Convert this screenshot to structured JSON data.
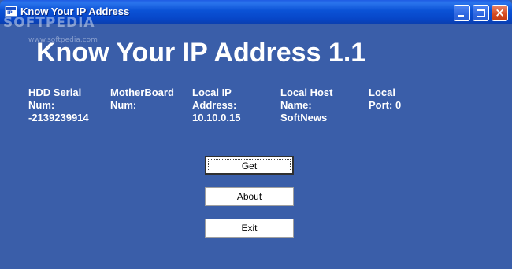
{
  "window": {
    "title": "Know Your IP Address",
    "watermark": "SOFTPEDIA",
    "watermark_url": "www.softpedia.com",
    "controls": {
      "minimize": "minimize",
      "maximize": "maximize",
      "close": "×"
    }
  },
  "main": {
    "headline": "Know Your IP Address 1.1",
    "info": [
      {
        "lines": [
          "HDD Serial",
          "Num:",
          "-2139239914"
        ]
      },
      {
        "lines": [
          "MotherBoard",
          "Num:"
        ]
      },
      {
        "lines": [
          "Local IP",
          "Address:",
          "10.10.0.15"
        ]
      },
      {
        "lines": [
          "Local Host",
          "Name:",
          "SoftNews"
        ]
      },
      {
        "lines": [
          "Local",
          "Port: 0"
        ]
      }
    ]
  },
  "buttons": {
    "get": "Get",
    "about": "About",
    "exit": "Exit"
  },
  "colors": {
    "background": "#3a5ea9",
    "titlebar": "#0b52d6",
    "text": "#ffffff",
    "close": "#d6491f"
  }
}
